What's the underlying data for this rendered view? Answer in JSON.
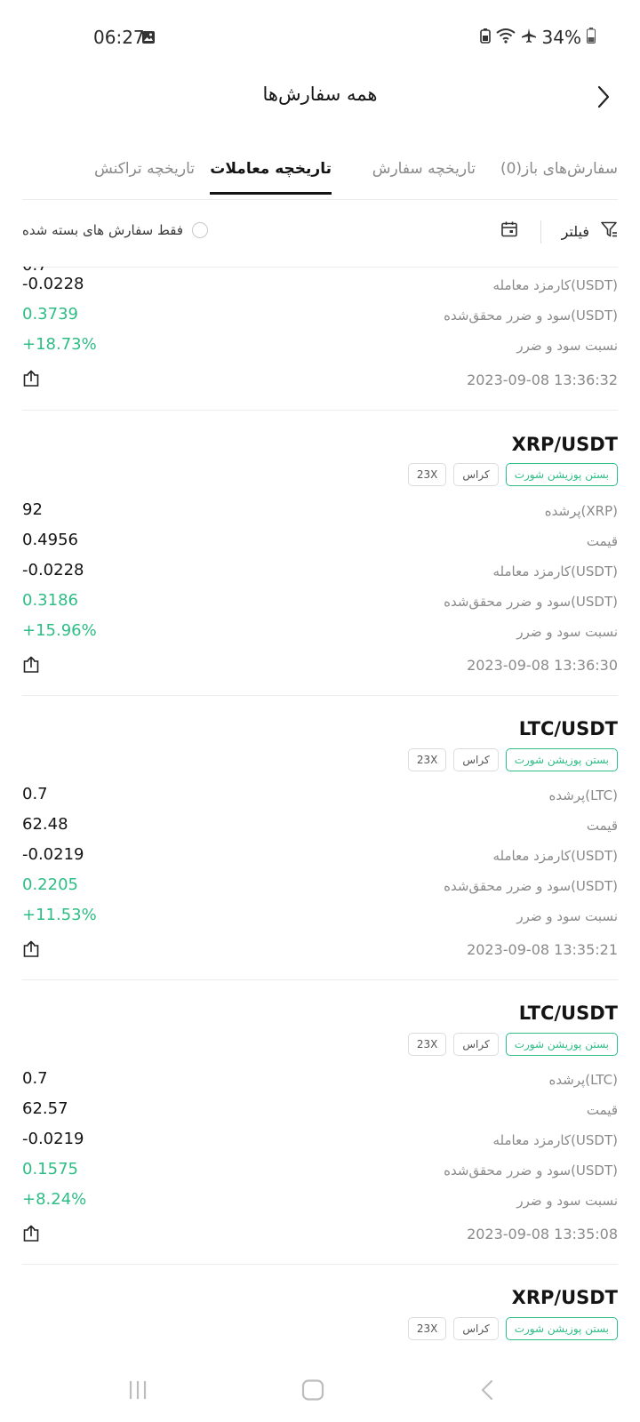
{
  "status_bar": {
    "time": "06:27",
    "battery": "34%"
  },
  "header": {
    "title": "همه سفارش‌ها"
  },
  "tabs": [
    {
      "label": "سفارش‌های باز(0)",
      "active": false
    },
    {
      "label": "تاریخچه سفارش",
      "active": false
    },
    {
      "label": "تاریخچه معاملات",
      "active": true
    },
    {
      "label": "تاریخچه تراکنش",
      "active": false
    }
  ],
  "filter_bar": {
    "filter_label": "فیلتر",
    "closed_only_label": "فقط سفارش های بسته شده"
  },
  "labels": {
    "filled": "پرشده",
    "price": "قیمت",
    "fee": "کارمزد معامله(USDT)",
    "pnl": "سود و ضرر محقق‌شده(USDT)",
    "pnl_ratio": "نسبت سود و ضرر"
  },
  "trades": [
    {
      "partial": true,
      "fee": "-0.0228",
      "pnl": "0.3739",
      "pnl_ratio": "+18.73%",
      "datetime": "2023-09-08 13:36:32"
    },
    {
      "pair": "XRP/USDT",
      "tags": {
        "side": "بستن پوزیشن شورت",
        "margin": "کراس",
        "leverage": "23X"
      },
      "filled_label": "پرشده(XRP)",
      "filled": "92",
      "price": "0.4956",
      "fee": "-0.0228",
      "pnl": "0.3186",
      "pnl_ratio": "+15.96%",
      "datetime": "2023-09-08 13:36:30"
    },
    {
      "pair": "LTC/USDT",
      "tags": {
        "side": "بستن پوزیشن شورت",
        "margin": "کراس",
        "leverage": "23X"
      },
      "filled_label": "پرشده(LTC)",
      "filled": "0.7",
      "price": "62.48",
      "fee": "-0.0219",
      "pnl": "0.2205",
      "pnl_ratio": "+11.53%",
      "datetime": "2023-09-08 13:35:21"
    },
    {
      "pair": "LTC/USDT",
      "tags": {
        "side": "بستن پوزیشن شورت",
        "margin": "کراس",
        "leverage": "23X"
      },
      "filled_label": "پرشده(LTC)",
      "filled": "0.7",
      "price": "62.57",
      "fee": "-0.0219",
      "pnl": "0.1575",
      "pnl_ratio": "+8.24%",
      "datetime": "2023-09-08 13:35:08"
    },
    {
      "pair": "XRP/USDT",
      "tags": {
        "side": "بستن پوزیشن شورت",
        "margin": "کراس",
        "leverage": "23X"
      }
    }
  ],
  "colors": {
    "positive": "#2ebd85",
    "muted": "#8a8a8a",
    "text": "#141414"
  },
  "icons": {
    "status": [
      "image-icon",
      "battery-saver-icon",
      "wifi-icon",
      "airplane-mode-icon",
      "battery-icon"
    ],
    "header": [
      "back-chevron-icon"
    ],
    "filter_bar": [
      "filter-icon",
      "calendar-icon"
    ],
    "rows": [
      "share-icon"
    ],
    "navbar": [
      "recents-icon",
      "home-icon",
      "back-icon"
    ]
  }
}
